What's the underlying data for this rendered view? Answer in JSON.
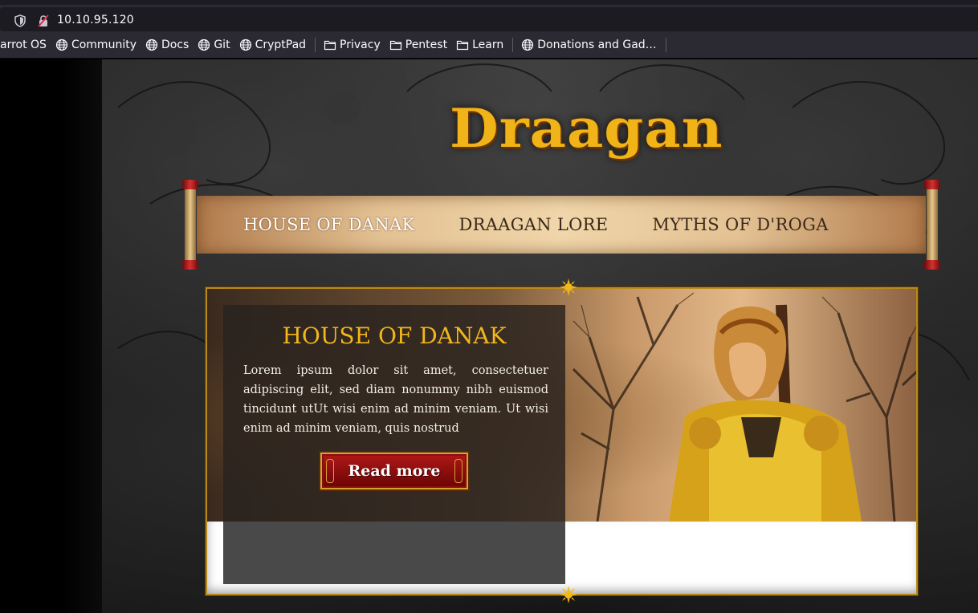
{
  "browser": {
    "url": "10.10.95.120",
    "bookmarks": [
      {
        "label": "arrot OS",
        "icon": "none"
      },
      {
        "label": "Community",
        "icon": "globe-icon"
      },
      {
        "label": "Docs",
        "icon": "globe-icon"
      },
      {
        "label": "Git",
        "icon": "globe-icon"
      },
      {
        "label": "CryptPad",
        "icon": "globe-icon"
      },
      {
        "label": "Privacy",
        "icon": "folder-icon"
      },
      {
        "label": "Pentest",
        "icon": "folder-icon"
      },
      {
        "label": "Learn",
        "icon": "folder-icon"
      },
      {
        "label": "Donations and Gad…",
        "icon": "globe-icon"
      }
    ]
  },
  "site": {
    "logo_text": "Draagan",
    "nav": [
      {
        "label": "HOUSE OF DANAK",
        "active": true
      },
      {
        "label": "DRAAGAN LORE",
        "active": false
      },
      {
        "label": "MYTHS OF D'ROGA",
        "active": false
      }
    ],
    "feature": {
      "title": "HOUSE OF DANAK",
      "body": "Lorem ipsum dolor sit amet, consectetuer adipiscing elit, sed diam nonummy nibh euismod tincidunt utUt wisi enim ad minim veniam. Ut wisi enim ad minim veniam, quis nostrud",
      "button_label": "Read more"
    }
  },
  "colors": {
    "accent_gold": "#f2b71c",
    "button_red": "#b01818",
    "frame_border": "#b98a1a"
  }
}
